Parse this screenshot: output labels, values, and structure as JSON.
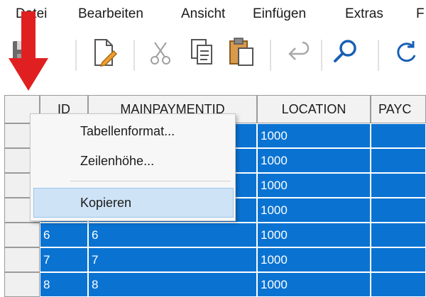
{
  "menubar": {
    "items": [
      {
        "label": "Datei"
      },
      {
        "label": "Bearbeiten"
      },
      {
        "label": "Ansicht"
      },
      {
        "label": "Einfügen"
      },
      {
        "label": "Extras"
      },
      {
        "label": "F"
      }
    ]
  },
  "toolbar": {
    "icons": [
      "save-icon",
      "edit-document-icon",
      "cut-icon",
      "copy-icon",
      "paste-icon",
      "undo-icon",
      "search-icon",
      "refresh-icon"
    ]
  },
  "table": {
    "columns": [
      "ID",
      "MAINPAYMENTID",
      "LOCATION",
      "PAYC"
    ],
    "rows": [
      {
        "id": "",
        "mainpaymentid": "",
        "location": "1000"
      },
      {
        "id": "",
        "mainpaymentid": "",
        "location": "1000"
      },
      {
        "id": "",
        "mainpaymentid": "",
        "location": "1000"
      },
      {
        "id": "",
        "mainpaymentid": "",
        "location": "1000"
      },
      {
        "id": "6",
        "mainpaymentid": "6",
        "location": "1000"
      },
      {
        "id": "7",
        "mainpaymentid": "7",
        "location": "1000"
      },
      {
        "id": "8",
        "mainpaymentid": "8",
        "location": "1000"
      }
    ]
  },
  "context_menu": {
    "items": [
      {
        "label": "Tabellenformat..."
      },
      {
        "label": "Zeilenhöhe..."
      },
      {
        "label": "Kopieren"
      }
    ]
  },
  "colors": {
    "selection": "#0a73d2",
    "arrow": "#e02020",
    "menu_highlight": "#cfe3f7"
  }
}
